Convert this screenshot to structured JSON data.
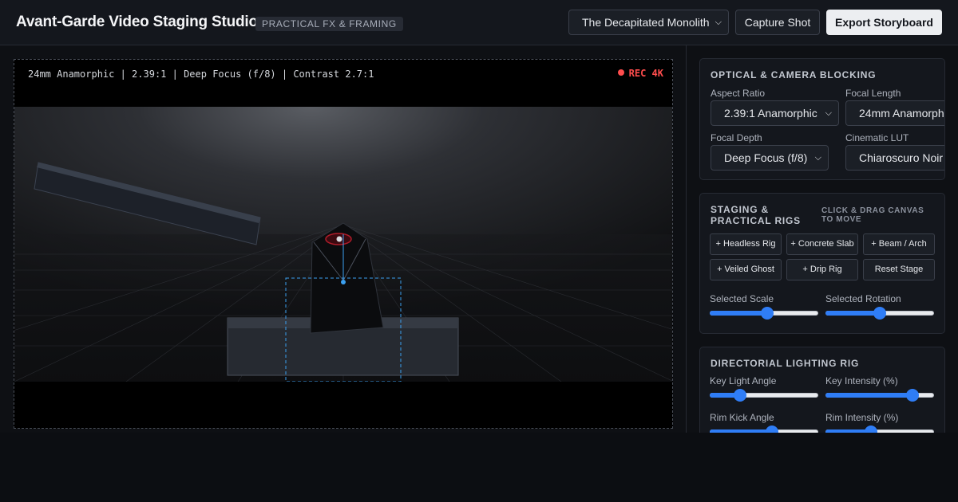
{
  "header": {
    "title": "Avant-Garde Video Staging Studio",
    "badge": "PRACTICAL FX & FRAMING",
    "scene_select": "The Decapitated Monolith",
    "capture_label": "Capture Shot",
    "export_label": "Export Storyboard"
  },
  "viewport": {
    "info": "24mm Anamorphic | 2.39:1 | Deep Focus (f/8) | Contrast 2.7:1",
    "rec_label": "REC 4K",
    "rec_color": "#ff4d4d"
  },
  "optical": {
    "title": "Optical & Camera Blocking",
    "aspect_label": "Aspect Ratio",
    "aspect_value": "2.39:1 Anamorphic",
    "focal_length_label": "Focal Length",
    "focal_length_value": "24mm Anamorphic",
    "focal_depth_label": "Focal Depth",
    "focal_depth_value": "Deep Focus (f/8)",
    "lut_label": "Cinematic LUT",
    "lut_value": "Chiaroscuro Noir"
  },
  "staging": {
    "title_line1": "Staging &",
    "title_line2": "Practical Rigs",
    "hint_line1": "Click & Drag Canvas",
    "hint_line2": "To Move",
    "buttons": [
      "+ Headless Rig",
      "+ Concrete Slab",
      "+ Beam / Arch",
      "+ Veiled Ghost",
      "+ Drip Rig",
      "Reset Stage"
    ],
    "scale_label": "Selected Scale",
    "scale_value": 0.53,
    "rotation_label": "Selected Rotation",
    "rotation_value": 0.5
  },
  "lighting": {
    "title": "Directorial Lighting Rig",
    "key_angle_label": "Key Light Angle",
    "key_angle_value": 0.28,
    "key_intensity_label": "Key Intensity (%)",
    "key_intensity_value": 0.8,
    "rim_angle_label": "Rim Kick Angle",
    "rim_angle_value": 0.57,
    "rim_intensity_label": "Rim Intensity (%)",
    "rim_intensity_value": 0.42
  },
  "colors": {
    "accent": "#2f7df6",
    "selection": "#3ba0f0",
    "eye_glow": "#b01c2a"
  },
  "icons": {
    "select_chevron": "chevron-down-icon",
    "rec_dot": "recording-dot-icon"
  }
}
